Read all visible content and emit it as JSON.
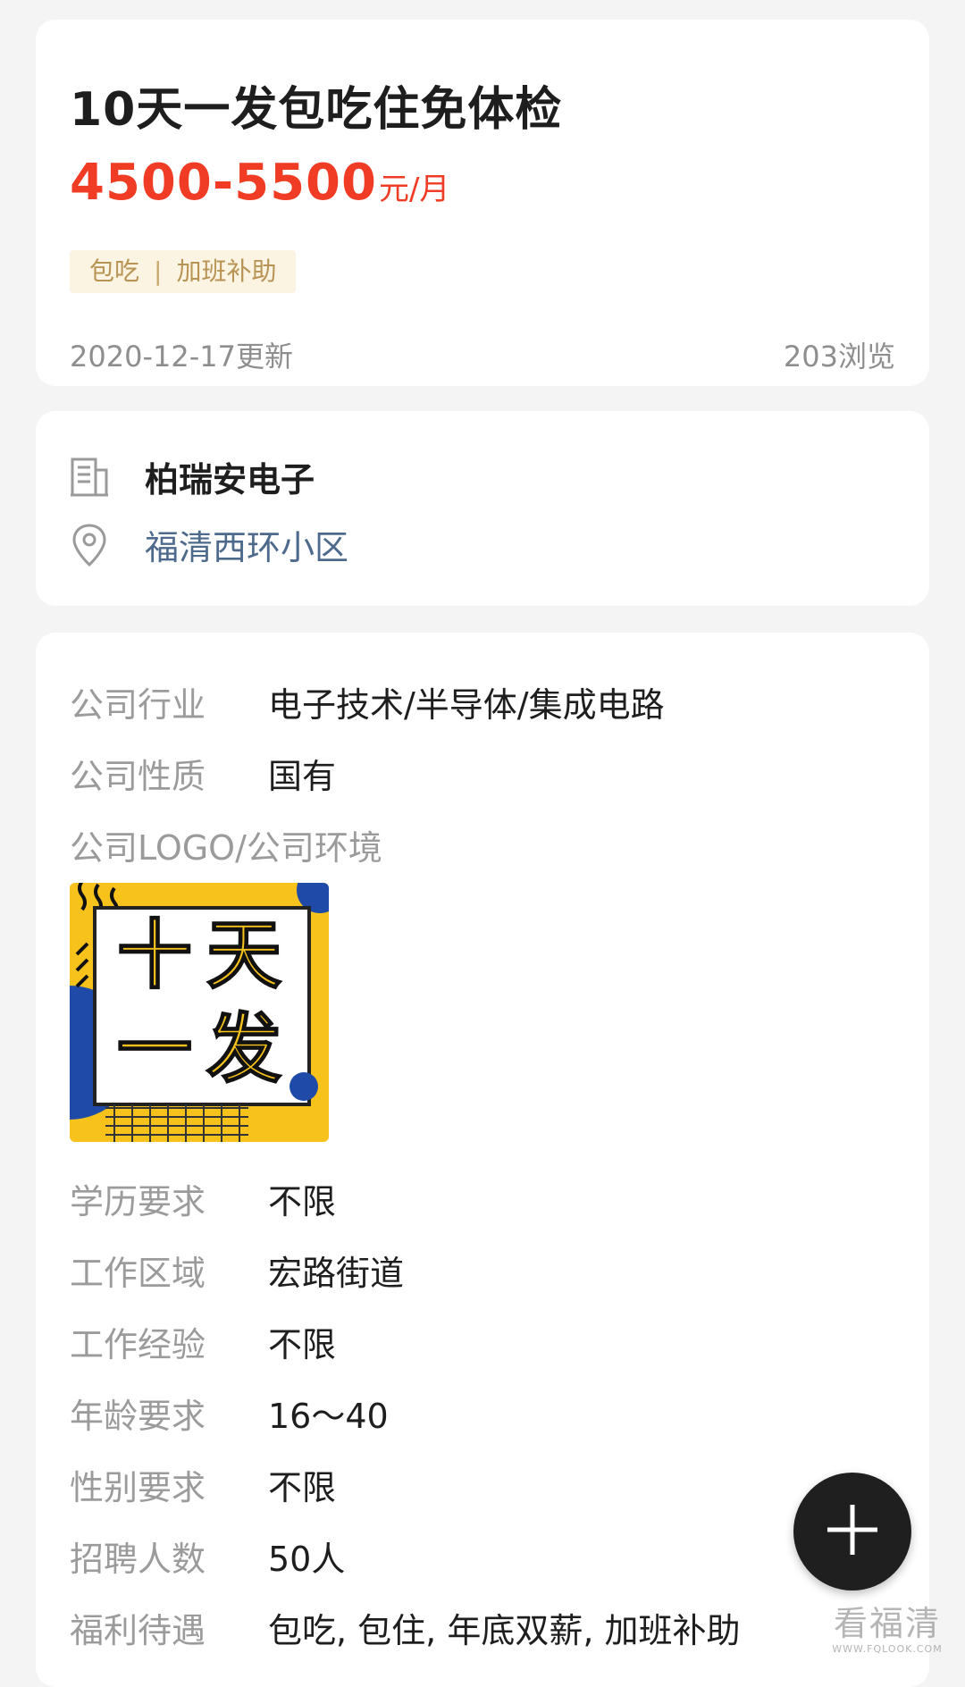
{
  "job": {
    "title": "10天一发包吃住免体检",
    "salary": "4500-5500",
    "salary_unit": "元/月",
    "tags": [
      "包吃",
      "加班补助"
    ],
    "tag_separator": "|",
    "updated": "2020-12-17更新",
    "views": "203浏览"
  },
  "company": {
    "name": "柏瑞安电子",
    "address": "福清西环小区",
    "icons": [
      "building-icon",
      "location-pin-icon"
    ]
  },
  "details": {
    "industry_label": "公司行业",
    "industry_value": "电子技术/半导体/集成电路",
    "nature_label": "公司性质",
    "nature_value": "国有",
    "photo_label": "公司LOGO/公司环境",
    "logo_text": [
      "十",
      "天",
      "一",
      "发"
    ],
    "education_label": "学历要求",
    "education_value": "不限",
    "area_label": "工作区域",
    "area_value": "宏路街道",
    "experience_label": "工作经验",
    "experience_value": "不限",
    "age_label": "年龄要求",
    "age_value": "16～40",
    "gender_label": "性别要求",
    "gender_value": "不限",
    "headcount_label": "招聘人数",
    "headcount_value": "50人",
    "benefits_label": "福利待遇",
    "benefits_value": "包吃, 包住, 年底双薪, 加班补助"
  },
  "fab": {
    "icon": "plus-icon"
  },
  "watermark": {
    "main": "看福清",
    "sub": "WWW.FQLOOK.COM"
  },
  "colors": {
    "background": "#f4f4f4",
    "salary": "#f03c24",
    "tag_bg": "#fcf4e2",
    "tag_text": "#b89354",
    "address": "#4d6a8c",
    "logo_yellow": "#f7c21c",
    "logo_blue": "#1f4aa8",
    "fab": "#1f1f1f"
  }
}
